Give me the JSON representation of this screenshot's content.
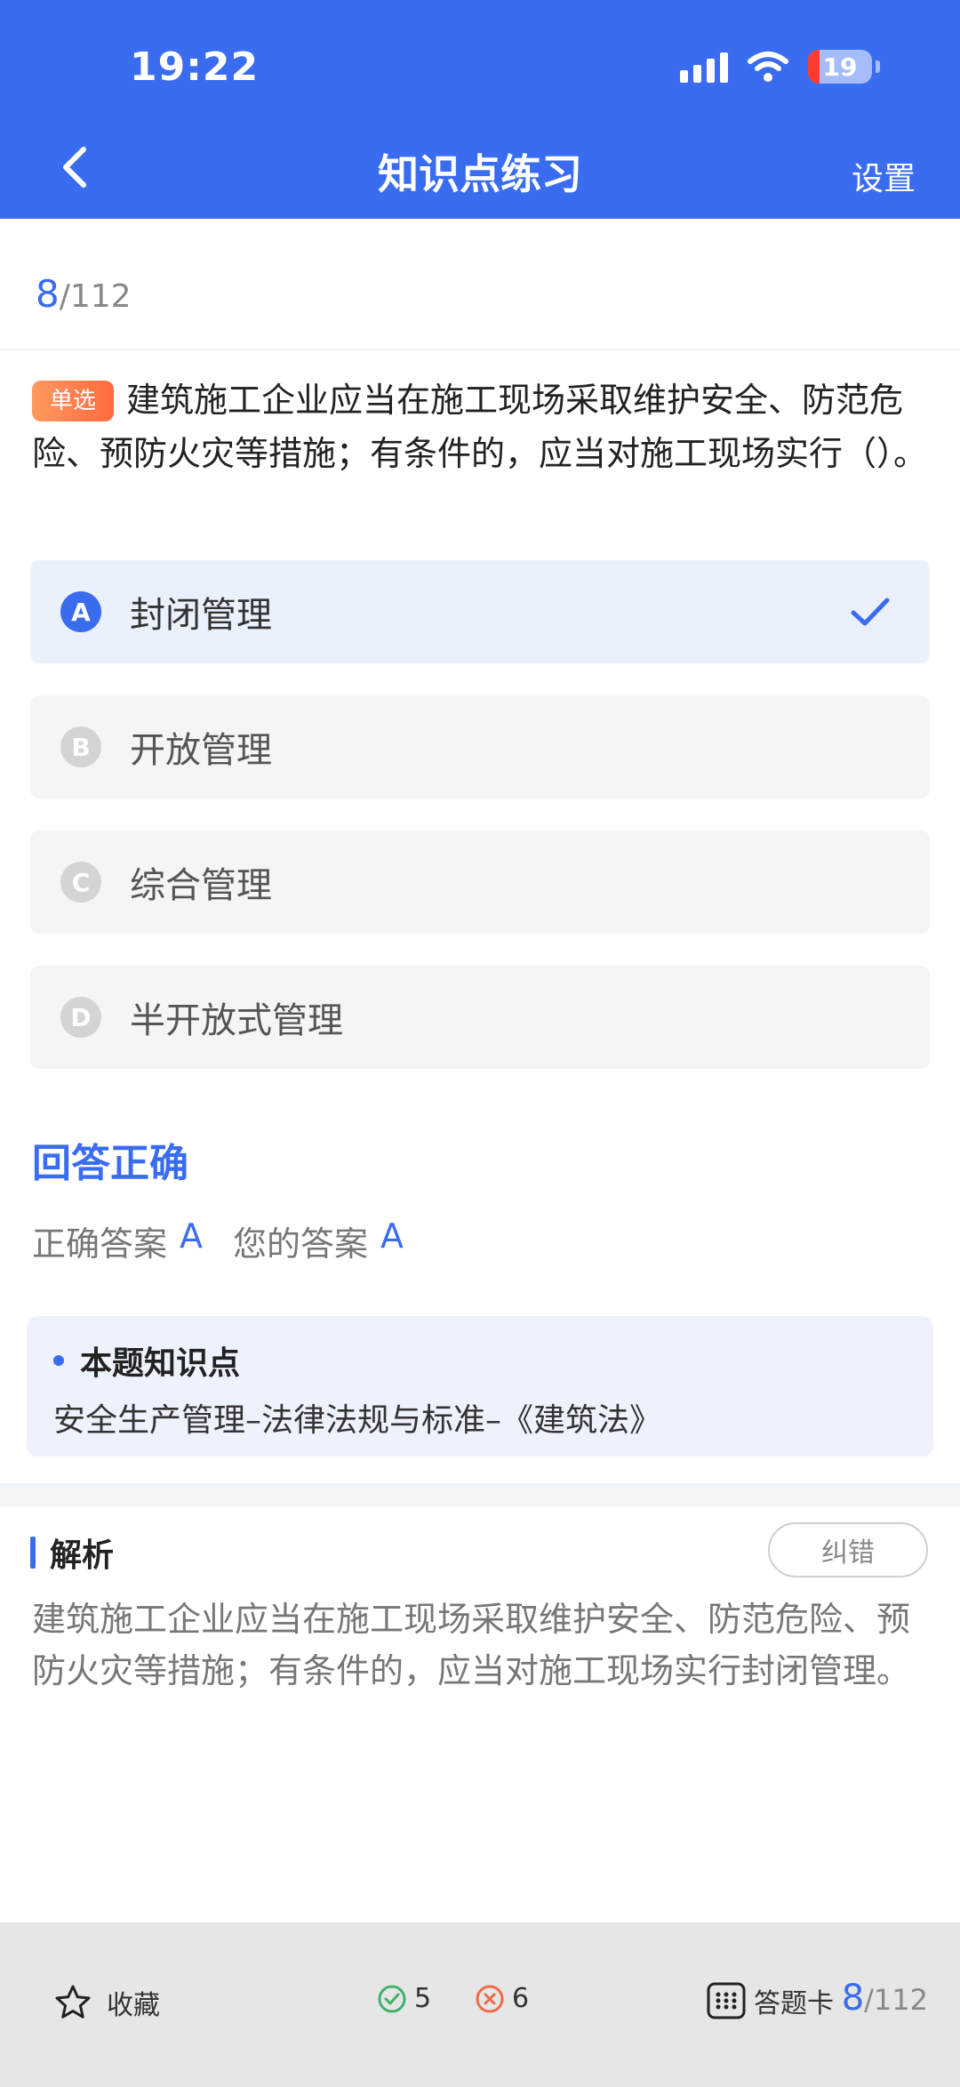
{
  "status_bar": {
    "time": "19:22",
    "battery": "19"
  },
  "nav": {
    "title": "知识点练习",
    "settings_label": "设置"
  },
  "progress": {
    "current": "8",
    "total": "/112"
  },
  "question": {
    "type_tag": "单选",
    "text": "建筑施工企业应当在施工现场采取维护安全、防范危险、预防火灾等措施；有条件的，应当对施工现场实行（）。"
  },
  "options": [
    {
      "letter": "A",
      "text": "封闭管理",
      "selected": true
    },
    {
      "letter": "B",
      "text": "开放管理",
      "selected": false
    },
    {
      "letter": "C",
      "text": "综合管理",
      "selected": false
    },
    {
      "letter": "D",
      "text": "半开放式管理",
      "selected": false
    }
  ],
  "result": {
    "title": "回答正确",
    "correct_label": "正确答案",
    "correct_value": "A",
    "your_label": "您的答案",
    "your_value": "A"
  },
  "knowledge_point": {
    "heading": "本题知识点",
    "text": "安全生产管理–法律法规与标准–《建筑法》"
  },
  "analysis": {
    "heading": "解析",
    "correct_error_label": "纠错",
    "text": "建筑施工企业应当在施工现场采取维护安全、防范危险、预防火灾等措施；有条件的，应当对施工现场实行封闭管理。"
  },
  "bottom_bar": {
    "favorite_label": "收藏",
    "right_count": "5",
    "wrong_count": "6",
    "answer_card_label": "答题卡",
    "progress_current": "8",
    "progress_total": "/112"
  },
  "colors": {
    "accent": "#3a6cf0",
    "tag": "#ff7a45",
    "right": "#3fb26b",
    "wrong": "#f06a4a"
  },
  "icons": [
    "back-chevron-icon",
    "signal-icon",
    "wifi-icon",
    "battery-icon",
    "check-icon",
    "star-icon",
    "check-circle-icon",
    "cross-circle-icon",
    "grid-icon"
  ]
}
